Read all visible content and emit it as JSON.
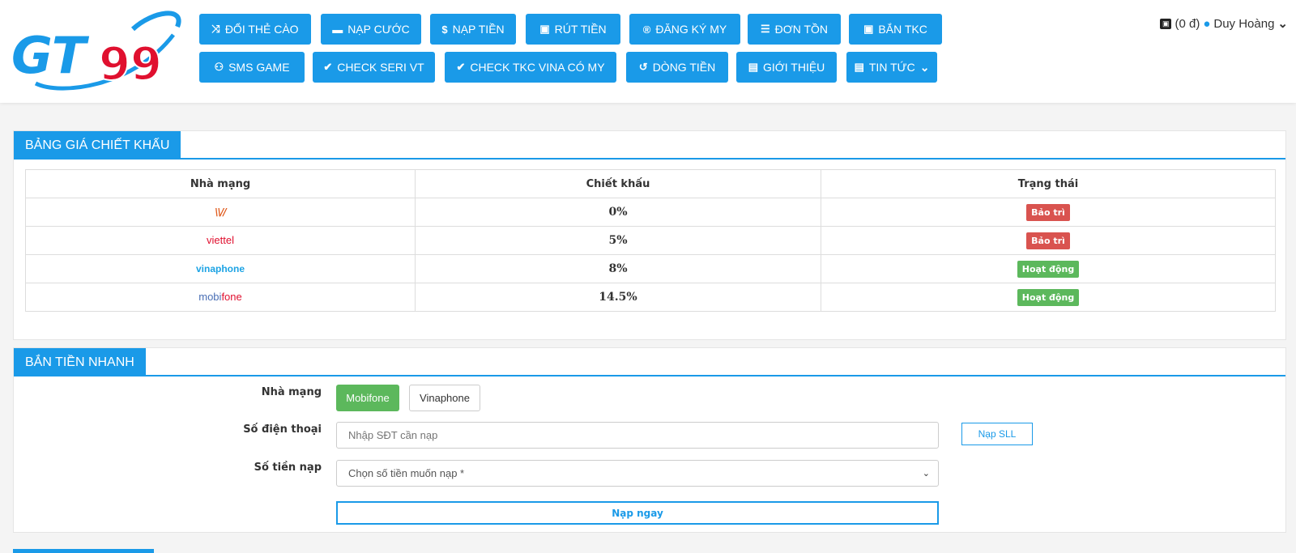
{
  "colors": {
    "primary": "#1a9ae8",
    "danger": "#d9534f",
    "success": "#5cb85c"
  },
  "nav": {
    "row1": [
      {
        "icon": "shuffle-icon",
        "glyph": "⤨",
        "label": "ĐỔI THẺ CÀO"
      },
      {
        "icon": "credit-card-icon",
        "glyph": "▬",
        "label": "NẠP CƯỚC"
      },
      {
        "icon": "dollar-icon",
        "glyph": "$",
        "label": "NẠP TIỀN"
      },
      {
        "icon": "money-bill-icon",
        "glyph": "▣",
        "label": "RÚT TIỀN"
      },
      {
        "icon": "registered-icon",
        "glyph": "®",
        "label": "ĐĂNG KÝ MY"
      },
      {
        "icon": "list-icon",
        "glyph": "☰",
        "label": "ĐƠN TỒN"
      },
      {
        "icon": "money-bill-icon",
        "glyph": "▣",
        "label": "BẮN TKC"
      }
    ],
    "row2": [
      {
        "icon": "gamepad-icon",
        "glyph": "⚇",
        "label": "SMS GAME"
      },
      {
        "icon": "check-icon",
        "glyph": "✔",
        "label": "CHECK SERI VT"
      },
      {
        "icon": "check-icon",
        "glyph": "✔",
        "label": "CHECK TKC VINA CÓ MY"
      },
      {
        "icon": "history-icon",
        "glyph": "↺",
        "label": "DÒNG TIỀN"
      },
      {
        "icon": "newspaper-icon",
        "glyph": "▤",
        "label": "GIỚI THIỆU"
      },
      {
        "icon": "newspaper-icon",
        "glyph": "▤",
        "label": "TIN TỨC",
        "dropdown": "⌄"
      }
    ]
  },
  "account": {
    "balance": "(0 đ)",
    "username": "Duy Hoàng",
    "caret": "⌄"
  },
  "logo": {
    "text_gt": "GT",
    "text_99": "99"
  },
  "discount_panel": {
    "title": "BẢNG GIÁ CHIẾT KHẤU",
    "headers": [
      "Nhà mạng",
      "Chiết khấu",
      "Trạng thái"
    ],
    "rows": [
      {
        "carrier": "vietnamobile",
        "logo_text": "\\\\//",
        "discount": "0%",
        "status": "Bảo trì",
        "status_type": "danger"
      },
      {
        "carrier": "viettel",
        "logo_text": "viettel",
        "discount": "5%",
        "status": "Bảo trì",
        "status_type": "danger"
      },
      {
        "carrier": "vinaphone",
        "logo_text": "vinaphone",
        "discount": "8%",
        "status": "Hoạt động",
        "status_type": "success"
      },
      {
        "carrier": "mobifone",
        "logo_text": "mobifone",
        "discount": "14.5%",
        "status": "Hoạt động",
        "status_type": "success"
      }
    ]
  },
  "quick_panel": {
    "title": "BẮN TIỀN NHANH",
    "network_label": "Nhà mạng",
    "networks": [
      "Mobifone",
      "Vinaphone"
    ],
    "network_selected": "Mobifone",
    "phone_label": "Số điện thoại",
    "phone_placeholder": "Nhập SĐT cần nạp",
    "bulk_button": "Nạp SLL",
    "amount_label": "Số tiền nạp",
    "amount_selected": "Chọn số tiền muốn nạp *",
    "submit_button": "Nạp ngay"
  }
}
